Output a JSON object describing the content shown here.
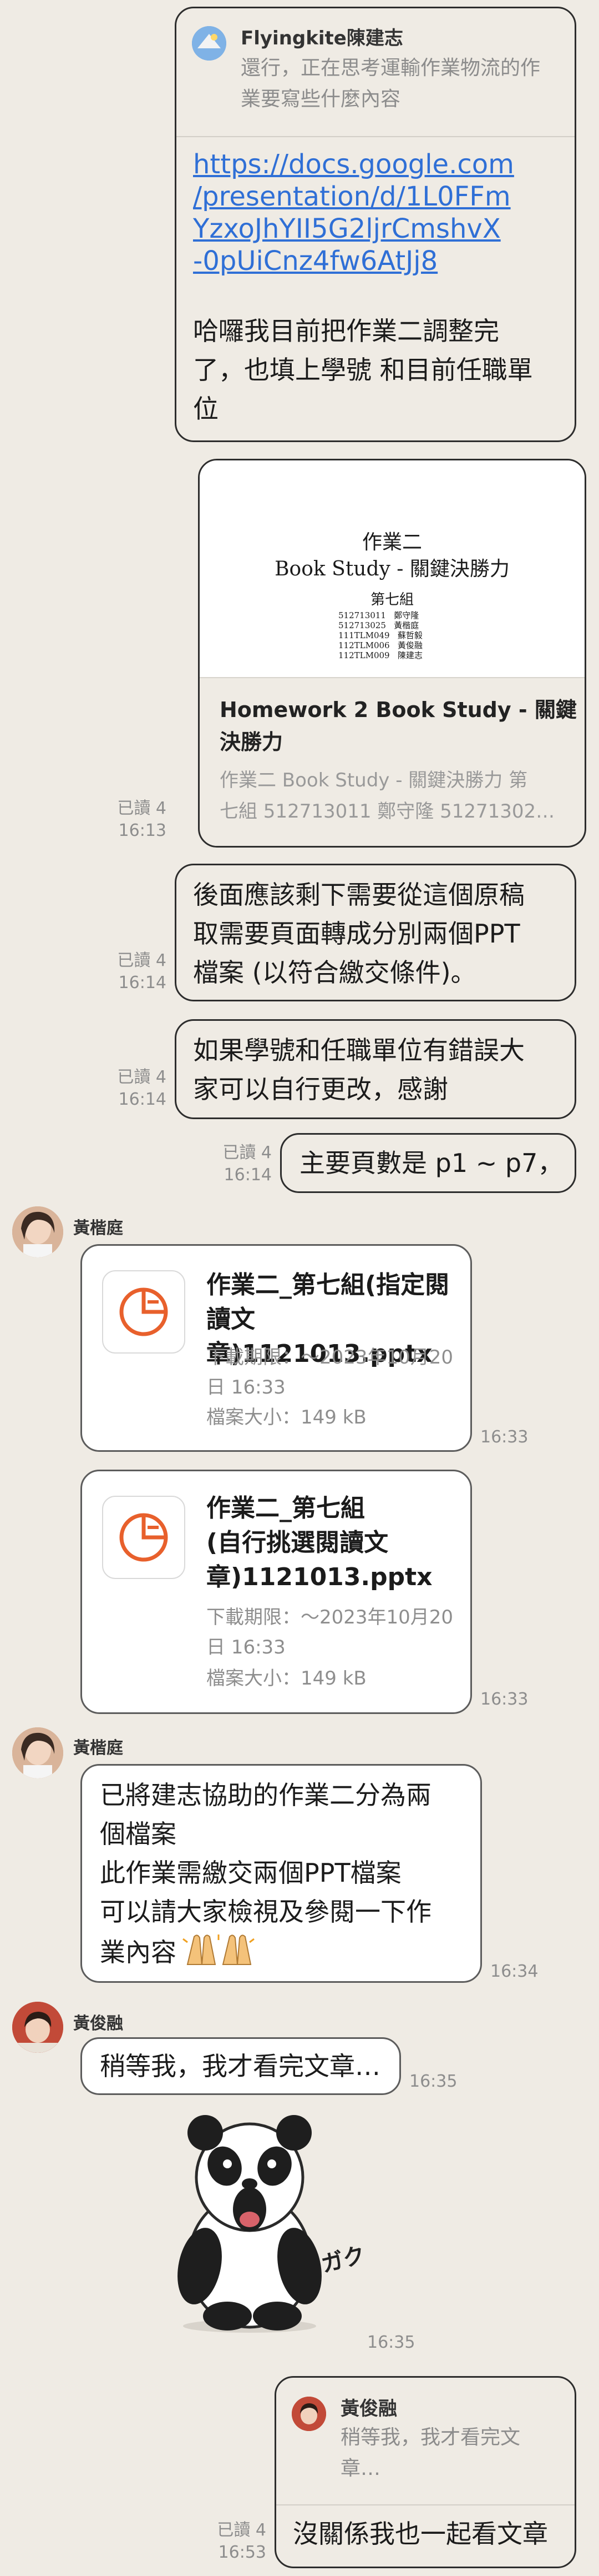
{
  "colors": {
    "background": "#efebe4",
    "bubble_border": "#2d2d2d",
    "link": "#2f6fd6",
    "file_icon": "#e8602c"
  },
  "msg1": {
    "reply_name": "Flyingkite陳建志",
    "reply_text_line1": "還行，正在思考運輸作業物流的作",
    "reply_text_line2": "業要寫些什麼內容",
    "link_lines": [
      "https://docs.google.com",
      "/presentation/d/1L0FFm",
      "YzxoJhYII5G2ljrCmshvX",
      "-0pUiCnz4fw6AtJj8"
    ],
    "body_lines": [
      "哈囉我目前把作業二調整完",
      "了，也填上學號 和目前任職單",
      "位"
    ]
  },
  "preview": {
    "slide_title": "作業二",
    "slide_subtitle": "Book Study - 關鍵決勝力",
    "slide_group": "第七組",
    "members": [
      {
        "id": "512713011",
        "name": "鄭守隆"
      },
      {
        "id": "512713025",
        "name": "黃楷庭"
      },
      {
        "id": "111TLM049",
        "name": "蘇哲毅"
      },
      {
        "id": "112TLM006",
        "name": "黃俊融"
      },
      {
        "id": "112TLM009",
        "name": "陳建志"
      }
    ],
    "title_line1": "Homework 2 Book Study - 關鍵",
    "title_line2": "決勝力",
    "desc_line1": "作業二 Book Study - 關鍵決勝力 第",
    "desc_line2": "七組 512713011 鄭守隆 51271302…",
    "read": "已讀 4",
    "time": "16:13"
  },
  "msg2": {
    "lines": [
      "後面應該剩下需要從這個原稿",
      "取需要頁面轉成分別兩個PPT",
      "檔案 (以符合繳交條件)。"
    ],
    "read": "已讀 4",
    "time": "16:14"
  },
  "msg3": {
    "lines": [
      "如果學號和任職單位有錯誤大",
      "家可以自行更改，感謝"
    ],
    "read": "已讀 4",
    "time": "16:14"
  },
  "msg4": {
    "text": "主要頁數是 p1 ~ p7，",
    "read": "已讀 4",
    "time": "16:14"
  },
  "file1": {
    "sender": "黃楷庭",
    "title_lines": [
      "作業二_第七組(指定閱",
      "讀文章)1121013.pptx"
    ],
    "expiry_lines": [
      "下載期限：～2023年10月20",
      "日 16:33"
    ],
    "size": "檔案大小：149 kB",
    "time": "16:33"
  },
  "file2": {
    "title_lines": [
      "作業二_第七組",
      "(自行挑選閱讀文",
      "章)1121013.pptx"
    ],
    "expiry_lines": [
      "下載期限：～2023年10月20",
      "日 16:33"
    ],
    "size": "檔案大小：149 kB",
    "time": "16:33"
  },
  "msg5": {
    "sender": "黃楷庭",
    "lines": [
      "已將建志協助的作業二分為兩",
      "個檔案",
      "此作業需繳交兩個PPT檔案",
      "可以請大家檢視及參閱一下作",
      "業內容"
    ],
    "time": "16:34"
  },
  "msg6": {
    "sender": "黃俊融",
    "text": "稍等我，我才看完文章…",
    "time": "16:35"
  },
  "sticker": {
    "caption": "ガク",
    "time": "16:35"
  },
  "msg7": {
    "reply_name": "黃俊融",
    "reply_text_line1": "稍等我，我才看完文",
    "reply_text_line2": "章…",
    "text": "沒關係我也一起看文章",
    "read": "已讀 4",
    "time": "16:53"
  }
}
